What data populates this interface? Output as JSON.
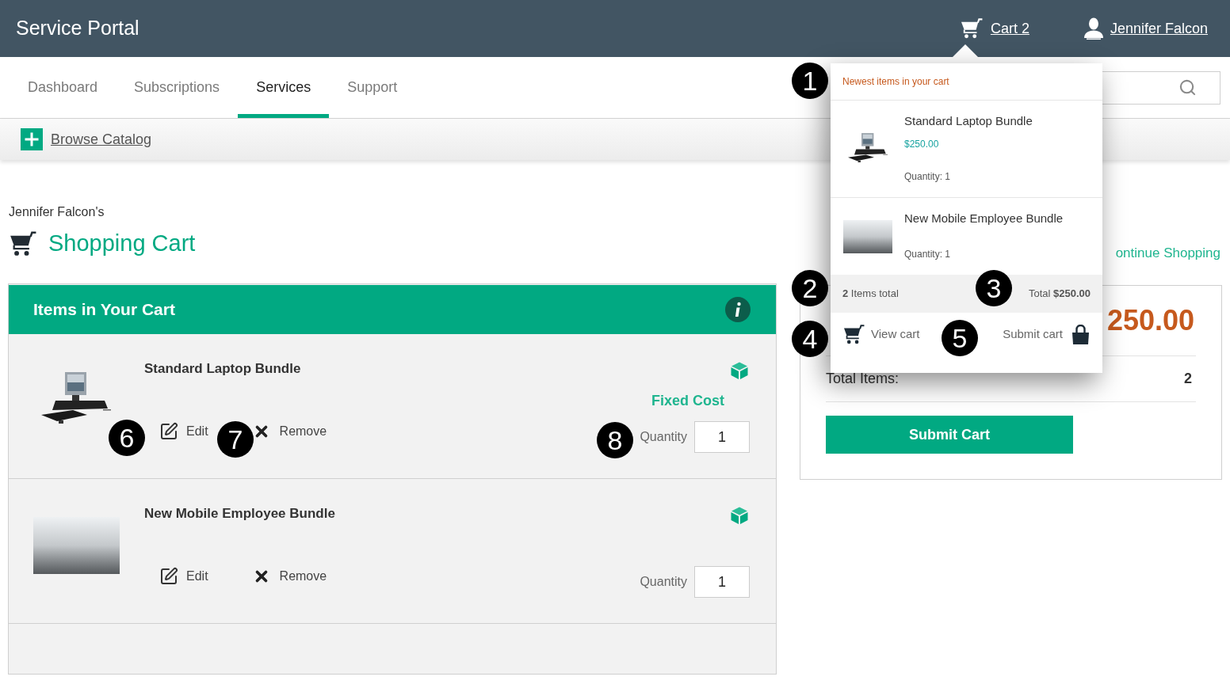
{
  "header": {
    "title": "Service Portal",
    "cart_link": "Cart 2",
    "user_link": "Jennifer Falcon"
  },
  "nav": {
    "tabs": [
      {
        "label": "Dashboard",
        "selected": false
      },
      {
        "label": "Subscriptions",
        "selected": false
      },
      {
        "label": "Services",
        "selected": true
      },
      {
        "label": "Support",
        "selected": false
      }
    ]
  },
  "toolbar": {
    "browse_link": "Browse Catalog"
  },
  "page": {
    "owner": "Jennifer Falcon's",
    "title": "Shopping Cart",
    "continue_link": "ontinue Shopping"
  },
  "items_panel": {
    "heading": "Items in Your Cart",
    "items": [
      {
        "kind": "hardware",
        "name": "Standard Laptop Bundle",
        "edit": "Edit",
        "remove": "Remove",
        "cost_type": "Fixed Cost",
        "quantity_label": "Quantity",
        "quantity": "1"
      },
      {
        "kind": "photo",
        "name": "New Mobile Employee Bundle",
        "edit": "Edit",
        "remove": "Remove",
        "quantity_label": "Quantity",
        "quantity": "1"
      }
    ]
  },
  "summary": {
    "total_price": "250.00",
    "total_items_label": "Total Items:",
    "total_items": "2",
    "submit_button": "Submit Cart"
  },
  "cart_dropdown": {
    "heading": "Newest items in your cart",
    "items": [
      {
        "kind": "hardware",
        "name": "Standard Laptop Bundle",
        "price": "$250.00",
        "quantity": "Quantity: 1"
      },
      {
        "kind": "photo",
        "name": "New Mobile Employee Bundle",
        "quantity": "Quantity: 1"
      }
    ],
    "items_total": "**2** Items total",
    "total": "Total **$250.00**",
    "view_cart": "View cart",
    "submit_cart": "Submit cart"
  },
  "callouts": [
    {
      "number": "1"
    },
    {
      "number": "2"
    },
    {
      "number": "3"
    },
    {
      "number": "4"
    },
    {
      "number": "5"
    },
    {
      "number": "6"
    },
    {
      "number": "7"
    },
    {
      "number": "8"
    }
  ]
}
